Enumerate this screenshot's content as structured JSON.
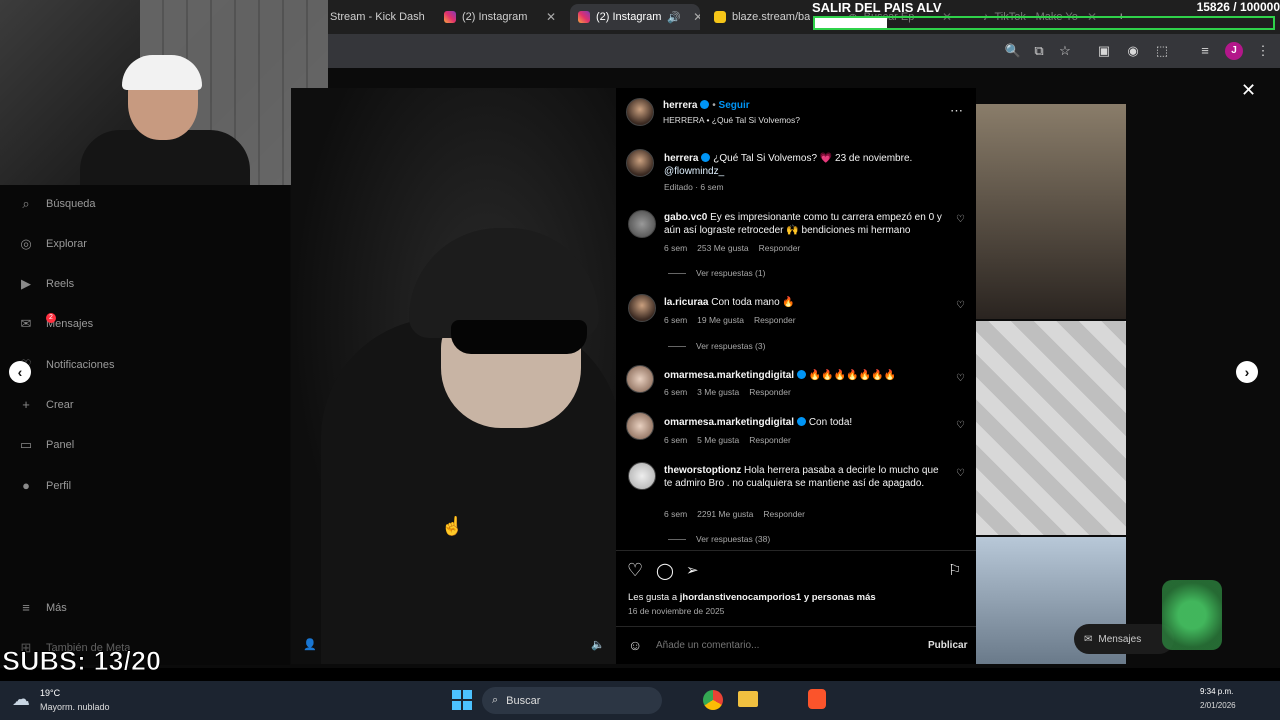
{
  "browser": {
    "tabs": [
      {
        "label": "Stream - Kick Dash",
        "icon": "kick-icon",
        "active": false
      },
      {
        "label": "(2) Instagram",
        "icon": "instagram-icon",
        "active": false
      },
      {
        "label": "(2) Instagram",
        "icon": "instagram-icon",
        "active": true
      },
      {
        "label": "blaze.stream/back",
        "icon": "blaze-icon",
        "active": false
      },
      {
        "label": "Buscar Ep",
        "icon": "globe-icon",
        "active": false
      },
      {
        "label": "TikTok - Make Yo",
        "icon": "tiktok-icon",
        "active": false
      }
    ],
    "profile_initial": "J"
  },
  "overlay": {
    "goal_title": "SALIR DEL PAIS ALV",
    "goal_count": "15826 / 100000",
    "goal_progress": 0.158
  },
  "sidebar": {
    "items": [
      {
        "label": "Búsqueda",
        "icon": "search-icon"
      },
      {
        "label": "Explorar",
        "icon": "compass-icon"
      },
      {
        "label": "Reels",
        "icon": "reels-icon"
      },
      {
        "label": "Mensajes",
        "icon": "messenger-icon",
        "badge": "2"
      },
      {
        "label": "Notificaciones",
        "icon": "heart-icon"
      },
      {
        "label": "Crear",
        "icon": "plus-icon"
      },
      {
        "label": "Panel",
        "icon": "dashboard-icon"
      },
      {
        "label": "Perfil",
        "icon": "profile-icon"
      }
    ],
    "more": "Más",
    "also_meta": "También de Meta"
  },
  "post": {
    "username": "herrera",
    "follow": "Seguir",
    "audio": "HERRERA • ¿Qué Tal Si Volvemos?",
    "caption_user": "herrera",
    "caption_text": "¿Qué Tal Si Volvemos? 💗 23 de noviembre.",
    "caption_mention": "@flowmindz_",
    "caption_meta": "Editado · 6 sem",
    "comments": [
      {
        "user": "gabo.vc0",
        "verified": false,
        "text": "Ey es impresionante como tu carrera empezó en 0 y aún así lograste retroceder 🙌 bendiciones mi hermano",
        "age": "6 sem",
        "likes": "253 Me gusta",
        "reply": "Responder",
        "replies": "Ver respuestas (1)"
      },
      {
        "user": "la.ricuraa",
        "verified": false,
        "text": "Con toda mano 🔥",
        "age": "6 sem",
        "likes": "19 Me gusta",
        "reply": "Responder",
        "replies": "Ver respuestas (3)"
      },
      {
        "user": "omarmesa.marketingdigital",
        "verified": true,
        "text": "🔥🔥🔥🔥🔥🔥🔥",
        "age": "6 sem",
        "likes": "3 Me gusta",
        "reply": "Responder",
        "replies": ""
      },
      {
        "user": "omarmesa.marketingdigital",
        "verified": true,
        "text": "Con toda!",
        "age": "6 sem",
        "likes": "5 Me gusta",
        "reply": "Responder",
        "replies": ""
      },
      {
        "user": "theworstoptionz",
        "verified": false,
        "text": "Hola herrera pasaba a decirle lo mucho que te admiro Bro . no cualquiera se mantiene así de apagado.",
        "age": "6 sem",
        "likes": "2291 Me gusta",
        "reply": "Responder",
        "replies": "Ver respuestas (38)"
      }
    ],
    "likes_line_prefix": "Les gusta a ",
    "likes_user": "jhordanstivenocamporios1",
    "likes_line_suffix": " y personas más",
    "date": "16 de noviembre de 2025",
    "comment_placeholder": "Añade un comentario...",
    "publish": "Publicar"
  },
  "floating_messages": "Mensajes",
  "stream": {
    "subs": "SUBS: 13/20"
  },
  "taskbar": {
    "weather_temp": "19°C",
    "weather_desc": "Mayorm. nublado",
    "search": "Buscar",
    "time": "9:34 p.m.",
    "date": "2/01/2026"
  }
}
